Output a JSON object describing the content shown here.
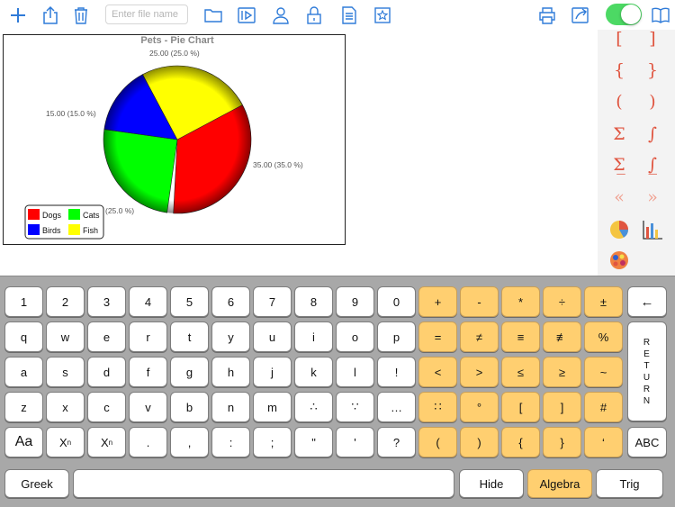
{
  "toolbar": {
    "file_name_placeholder": "Enter file name",
    "buttons": [
      "add-icon",
      "share-icon",
      "trash-icon",
      "folder-icon",
      "play-icon",
      "person-icon",
      "lock-icon",
      "document-icon",
      "star-icon",
      "print-icon",
      "export-icon",
      "book-icon"
    ],
    "toggle_on": true,
    "accent_color": "#2f7bd8",
    "toggle_color": "#4cd964"
  },
  "chart_data": {
    "type": "pie",
    "title": "Pets - Pie Chart",
    "categories": [
      "Dogs",
      "Cats",
      "Birds",
      "Fish"
    ],
    "values": [
      35,
      25,
      15,
      25
    ],
    "data_labels": [
      "35.00 (35.0 %)",
      "(25.0 %)",
      "15.00 (15.0 %)",
      "25.00 (25.0 %)"
    ],
    "colors": [
      "#ff0000",
      "#00ff00",
      "#0000ff",
      "#ffff00"
    ],
    "legend_placement": "bottom-left"
  },
  "palette": {
    "row1": [
      "[",
      "]"
    ],
    "row2": [
      "{",
      "}"
    ],
    "row3": [
      "(",
      ")"
    ],
    "row4": [
      "Σ",
      "∫"
    ],
    "row5": [
      "Σ̲",
      "∫̲"
    ],
    "row6": [
      "«",
      "»"
    ],
    "icons": [
      "pie-chart-icon",
      "bar-chart-icon",
      "color-palette-icon"
    ],
    "symbol_color": "#e05540"
  },
  "keyboard": {
    "row1": [
      "1",
      "2",
      "3",
      "4",
      "5",
      "6",
      "7",
      "8",
      "9",
      "0"
    ],
    "row1_ops": [
      "+",
      "-",
      "*",
      "÷",
      "±"
    ],
    "backspace": "←",
    "row2": [
      "q",
      "w",
      "e",
      "r",
      "t",
      "y",
      "u",
      "i",
      "o",
      "p"
    ],
    "row2_ops": [
      "=",
      "≠",
      "≡",
      "≢",
      "%"
    ],
    "row3": [
      "a",
      "s",
      "d",
      "f",
      "g",
      "h",
      "j",
      "k",
      "l",
      "!"
    ],
    "row3_ops": [
      "<",
      ">",
      "≤",
      "≥",
      "~"
    ],
    "row4": [
      "z",
      "x",
      "c",
      "v",
      "b",
      "n",
      "m",
      "∴",
      "∵",
      "…"
    ],
    "row4_ops": [
      "∷",
      "°",
      "[",
      "]",
      "#"
    ],
    "row5_font": "Aa",
    "row5_sup": "X",
    "row5_sup_mark": "n",
    "row5_sub": "X",
    "row5_sub_mark": "n",
    "row5": [
      ".",
      ",",
      ":",
      ";",
      "\"",
      "'",
      "?"
    ],
    "row5_ops": [
      "(",
      ")",
      "{",
      "}",
      "‘"
    ],
    "return_letters": [
      "R",
      "E",
      "T",
      "U",
      "R",
      "N"
    ],
    "abc": "ABC",
    "greek": "Greek",
    "space": "",
    "hide": "Hide",
    "algebra": "Algebra",
    "trig": "Trig",
    "op_color": "#ffcf70"
  }
}
